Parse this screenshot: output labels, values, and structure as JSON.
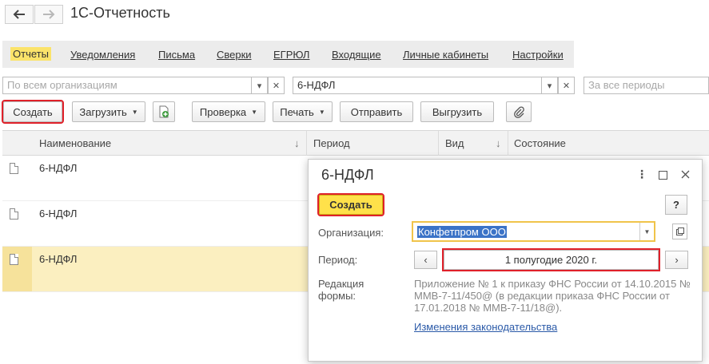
{
  "app": {
    "title": "1С-Отчетность"
  },
  "nav": {
    "back_icon": "arrow-left-icon",
    "forward_icon": "arrow-right-icon"
  },
  "tabs": [
    {
      "label": "Отчеты",
      "active": true
    },
    {
      "label": "Уведомления"
    },
    {
      "label": "Письма"
    },
    {
      "label": "Сверки"
    },
    {
      "label": "ЕГРЮЛ"
    },
    {
      "label": "Входящие"
    },
    {
      "label": "Личные кабинеты"
    },
    {
      "label": "Настройки"
    }
  ],
  "filters": {
    "organization_placeholder": "По всем организациям",
    "report_value": "6-НДФЛ",
    "period_placeholder": "За все периоды"
  },
  "toolbar": {
    "create": "Создать",
    "load": "Загрузить",
    "check": "Проверка",
    "print": "Печать",
    "send": "Отправить",
    "export": "Выгрузить"
  },
  "table": {
    "columns": [
      "Наименование",
      "Период",
      "Вид",
      "Состояние"
    ],
    "sort_arrow": "↓",
    "rows": [
      {
        "name": "6-НДФЛ",
        "selected": false
      },
      {
        "name": "6-НДФЛ",
        "selected": false
      },
      {
        "name": "6-НДФЛ",
        "selected": true
      }
    ]
  },
  "dialog": {
    "title": "6-НДФЛ",
    "create": "Создать",
    "help": "?",
    "org_label": "Организация:",
    "org_value": "Конфетпром ООО",
    "period_label": "Период:",
    "period_value": "1 полугодие 2020 г.",
    "edition_label_1": "Редакция",
    "edition_label_2": "формы:",
    "edition_text": "Приложение № 1 к приказу ФНС России от 14.10.2015 № ММВ-7-11/450@ (в редакции приказа ФНС России от 17.01.2018 № ММВ-7-11/18@).",
    "law_link": "Изменения законодательства"
  },
  "colors": {
    "highlight_red": "#e0212a",
    "active_tab": "#fbe36a",
    "primary_button": "#ffe14a",
    "selected_row": "#fbefc0",
    "link": "#2b5aa8"
  }
}
